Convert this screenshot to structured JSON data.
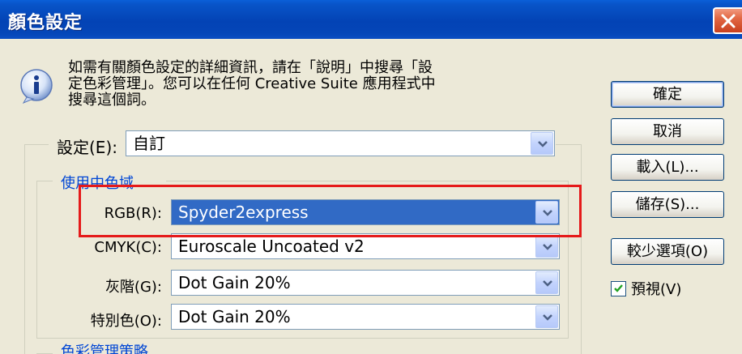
{
  "window": {
    "title": "顏色設定"
  },
  "info": {
    "text_line1": "如需有關顏色設定的詳細資訊，請在「說明」中搜尋「設",
    "text_line2": "定色彩管理」。您可以在任何 Creative Suite 應用程式中",
    "text_line3": "搜尋這個詞。"
  },
  "buttons": {
    "ok": "確定",
    "cancel": "取消",
    "load": "載入(L)...",
    "save": "儲存(S)...",
    "fewer_options": "較少選項(O)"
  },
  "preview": {
    "label": "預視(V)",
    "checked": true
  },
  "settings": {
    "label": "設定(E):",
    "value": "自訂"
  },
  "working_spaces": {
    "title": "使用中色域",
    "rows": [
      {
        "label": "RGB(R):",
        "value": "Spyder2express"
      },
      {
        "label": "CMYK(C):",
        "value": "Euroscale Uncoated v2"
      },
      {
        "label": "灰階(G):",
        "value": "Dot Gain 20%"
      },
      {
        "label": "特別色(O):",
        "value": "Dot Gain 20%"
      }
    ]
  },
  "color_management_policies": {
    "title": "色彩管理策略"
  },
  "colors": {
    "titlebar": "#0343B5",
    "dialog_bg": "#ECE9D8",
    "selection": "#316AC5",
    "highlight_box": "#E51A1A",
    "group_title": "#0046D5"
  }
}
